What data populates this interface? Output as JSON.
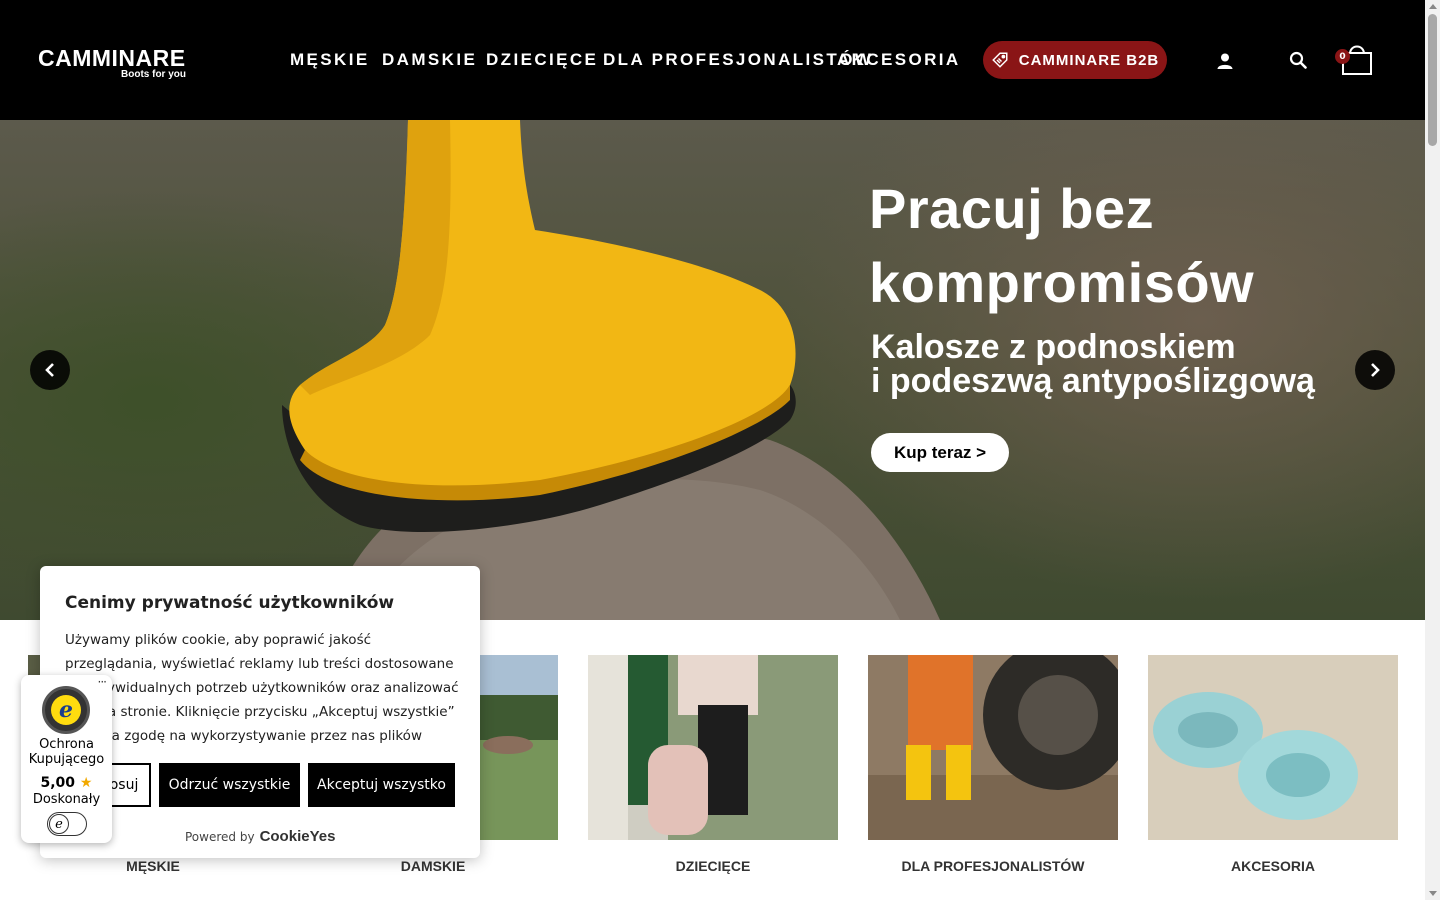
{
  "brand": {
    "name": "CAMMINARE",
    "tagline": "Boots for you"
  },
  "nav": {
    "items": [
      {
        "label": "MĘSKIE"
      },
      {
        "label": "DAMSKIE"
      },
      {
        "label": "DZIECIĘCE"
      },
      {
        "label": "DLA PROFESJONALISTÓW"
      },
      {
        "label": "AKCESORIA"
      }
    ],
    "b2b_label": "CAMMINARE B2B",
    "cart_count": "0",
    "icons": [
      "user-icon",
      "search-icon",
      "cart-icon"
    ]
  },
  "hero": {
    "title_line1": "Pracuj bez",
    "title_line2": "kompromisów",
    "subtitle_line1": "Kalosze z podnoskiem",
    "subtitle_line2": "i podeszwą antypoślizgową",
    "cta": "Kup teraz >"
  },
  "categories": [
    {
      "label": "MĘSKIE"
    },
    {
      "label": "DAMSKIE"
    },
    {
      "label": "DZIECIĘCE"
    },
    {
      "label": "DLA PROFESJONALISTÓW"
    },
    {
      "label": "AKCESORIA"
    }
  ],
  "cookie": {
    "title": "Cenimy prywatność użytkowników",
    "text": "Używamy plików cookie, aby poprawić jakość przeglądania, wyświetlać reklamy lub treści dostosowane do indywidualnych potrzeb użytkowników oraz analizować ruch na stronie. Kliknięcie przycisku „Akceptuj wszystkie” oznacza zgodę na wykorzystywanie przez nas plików cookie.",
    "customize": "Dostosuj",
    "reject": "Odrzuć wszystkie",
    "accept": "Akceptuj wszystko",
    "powered_by": "Powered by",
    "powered_brand": "CookieYes"
  },
  "trusted_shops": {
    "label": "Ochrona Kupującego",
    "score": "5,00",
    "grade": "Doskonały"
  },
  "colors": {
    "header_bg": "#000000",
    "accent": "#8a1516",
    "boot_yellow": "#f3b81a"
  }
}
